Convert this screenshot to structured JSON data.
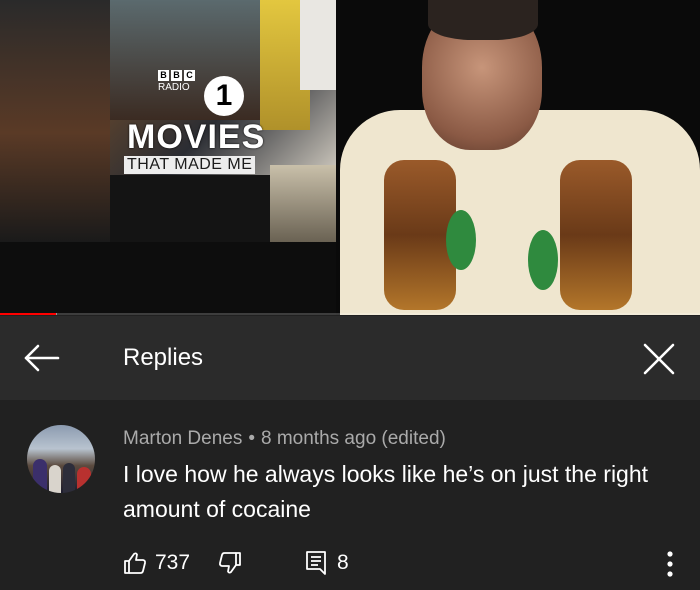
{
  "video": {
    "thumbnail_logo": {
      "bbc_letters": [
        "B",
        "B",
        "C"
      ],
      "radio": "RADIO",
      "station_number": "1",
      "title_line1": "MOVIES",
      "title_line2": "THAT MADE ME"
    },
    "progress": {
      "played_fraction": 0.08,
      "buffered_fraction": 0.082
    },
    "colors": {
      "progress": "#ff0000"
    }
  },
  "replies_panel": {
    "title": "Replies",
    "back_icon": "arrow-left-icon",
    "close_icon": "close-icon"
  },
  "comment": {
    "author": "Marton Denes",
    "separator": "•",
    "timestamp": "8 months ago (edited)",
    "text": "I love how he always looks like he’s on just the right amount of cocaine",
    "likes": "737",
    "replies": "8",
    "icons": {
      "like": "thumbs-up-icon",
      "dislike": "thumbs-down-icon",
      "reply": "comment-icon",
      "more": "more-vertical-icon"
    }
  },
  "colors": {
    "background": "#212121",
    "header_background": "#2b2b2b",
    "meta_text": "#aaaaaa",
    "text": "#ffffff"
  }
}
